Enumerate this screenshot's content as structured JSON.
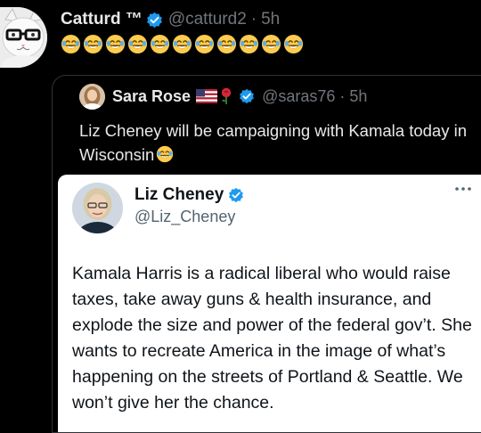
{
  "tweet": {
    "display_name": "Catturd ™",
    "handle": "@catturd2",
    "separator": "·",
    "time": "5h",
    "emoji_count": 11,
    "emoji_name": "face-with-tears-of-joy",
    "verified_color": "#1d9bf0"
  },
  "quote": {
    "display_name": "Sara Rose",
    "handle": "@saras76",
    "separator": "·",
    "time": "5h",
    "text": "Liz Cheney will be campaigning with Kamala today in Wisconsin",
    "icons": [
      "us-flag-icon",
      "rose-icon",
      "verified-badge-icon"
    ]
  },
  "embedded": {
    "display_name": "Liz Cheney",
    "handle": "@Liz_Cheney",
    "body": "Kamala Harris is a radical liberal who would raise taxes, take away guns & health insurance, and explode the size and power of the federal gov’t. She wants to recreate America in the image of what’s happening on the streets of Portland & Seattle. We won’t give her the chance."
  },
  "colors": {
    "background": "#000000",
    "text_primary": "#e7e9ea",
    "text_muted": "#71767b",
    "verified": "#1d9bf0",
    "embedded_background": "#ffffff",
    "embedded_text": "#0f1419",
    "embedded_muted": "#536471"
  }
}
